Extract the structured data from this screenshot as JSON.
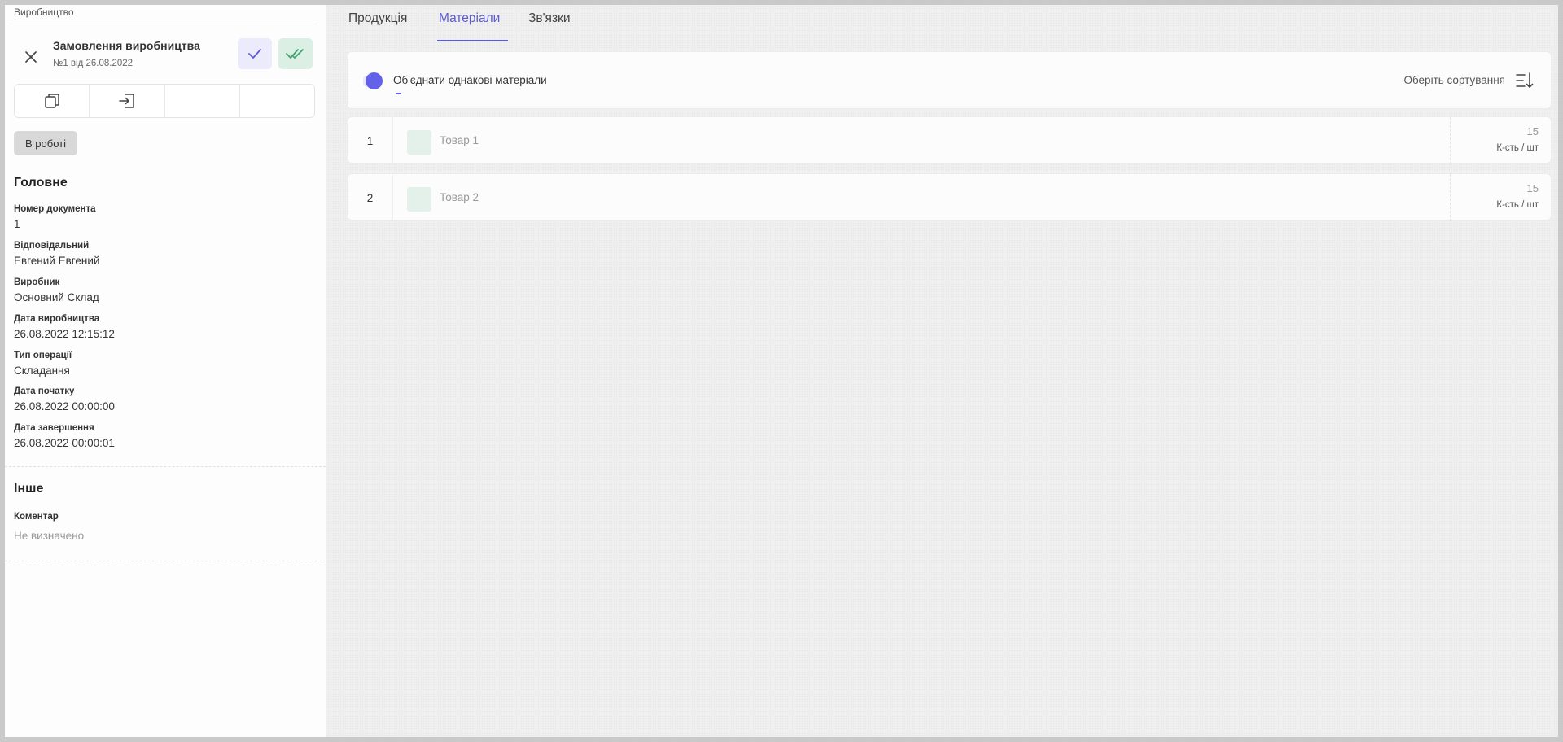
{
  "breadcrumb": "Виробництво",
  "document": {
    "title": "Замовлення виробництва",
    "subtitle": "№1 від 26.08.2022"
  },
  "icons": {
    "close": "close-icon",
    "confirm": "check-icon",
    "confirm_all": "double-check-icon",
    "copy": "copy-icon",
    "import": "import-icon",
    "sort": "sort-icon"
  },
  "colors": {
    "accent": "#5b5bd6",
    "toggle": "#6360ea",
    "confirm_bg": "#ecebfb",
    "confirm_all_bg": "#dcefe4",
    "confirm_all_fg": "#3da26b"
  },
  "status": "В роботі",
  "main_section": {
    "title": "Головне",
    "fields": [
      {
        "label": "Номер документа",
        "value": "1"
      },
      {
        "label": "Відповідальний",
        "value": "Евгений Евгений"
      },
      {
        "label": "Виробник",
        "value": "Основний Склад"
      },
      {
        "label": "Дата виробництва",
        "value": "26.08.2022 12:15:12"
      },
      {
        "label": "Тип операції",
        "value": "Складання"
      },
      {
        "label": "Дата початку",
        "value": "26.08.2022 00:00:00"
      },
      {
        "label": "Дата завершення",
        "value": "26.08.2022 00:00:01"
      }
    ]
  },
  "other_section": {
    "title": "Інше",
    "fields": [
      {
        "label": "Коментар",
        "value": "Не визначено"
      }
    ]
  },
  "tabs": [
    {
      "label": "Продукція",
      "active": false
    },
    {
      "label": "Матеріали",
      "active": true
    },
    {
      "label": "Зв'язки",
      "active": false
    }
  ],
  "filter_bar": {
    "merge_label": "Об'єднати однакові матеріали",
    "merge_enabled": true,
    "sort_label": "Оберіть сортування"
  },
  "materials": [
    {
      "index": "1",
      "name": "Товар 1",
      "qty": "15",
      "unit": "К-сть / шт"
    },
    {
      "index": "2",
      "name": "Товар 2",
      "qty": "15",
      "unit": "К-сть / шт"
    }
  ]
}
